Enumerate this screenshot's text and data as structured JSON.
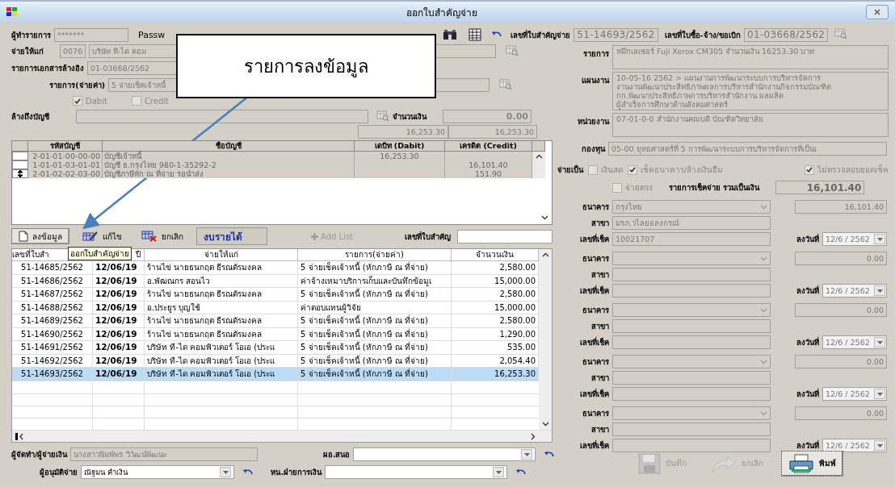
{
  "window": {
    "title": "ออกใบสำคัญจ่าย"
  },
  "top_bar": {
    "operator_label": "ผู้ทำรายการ",
    "operator_value": "*******",
    "password_label": "Passw",
    "voucher_label": "เลขที่ใบสำคัญจ่าย",
    "voucher_value": "51-14693/2562",
    "po_label": "เลขที่ใบซื้อ-จ้าง/ขอเบิก",
    "po_value": "01-03668/2562"
  },
  "callout": {
    "text": "รายการลงข้อมูล"
  },
  "entry": {
    "payee_label": "จ่ายให้แก่",
    "payee_code": "0076",
    "payee_name": "บริษัท ที-ได คอม",
    "ref_label": "รายการเอกสารล้างอิง",
    "ref_value": "01-03668/2562",
    "expense_label": "รายการ(จ่ายค่า)",
    "expense_value": "5 จ่ายเช็คเจ้าหนี้",
    "debit": {
      "label": "Dabit",
      "checked": true
    },
    "credit": {
      "label": "Credit",
      "checked": false
    },
    "account_label": "ล้างถึงบัญชี",
    "amount_label": "จำนวนเงิน",
    "amount_value": "0.00",
    "total_debit": "16,253.30",
    "total_credit": "16,253.30"
  },
  "accounts": {
    "columns": [
      "รหัสบัญชี",
      "ชื่อบัญชี",
      "เดบิท (Dabit)",
      "เครดิต (Credit)"
    ],
    "rows": [
      {
        "code": "2-01-01-00-00-00",
        "name": "บัญชีเจ้าหนี้",
        "debit": "16,253.30",
        "current": false
      },
      {
        "code": "1-01-01-03-01-01",
        "name": "บัญชี ธ.กรุงไทย 980-1-35292-2",
        "credit": "16,101.40",
        "current": false
      },
      {
        "code": "2-01-02-02-03-00",
        "name": "บัญชีภาษีหัก ณ ที่จ่าย รอนำส่ง",
        "credit": "151.90",
        "current": true
      }
    ]
  },
  "toolbar": {
    "buttons": [
      {
        "label": "ลงข้อมูล",
        "kind": "new"
      },
      {
        "label": "แก้ไข",
        "kind": "edit"
      },
      {
        "label": "ยกเลิก",
        "kind": "delete"
      }
    ],
    "budget": "งบรายได้",
    "add_list": {
      "label": "Add List",
      "disabled": true
    },
    "search_label": "เลขที่ใบสำคัญ"
  },
  "tooltip": "ออกใบสำคัญจ่าย",
  "vouchers": {
    "columns": [
      "เลขที่ใบสำ",
      "ปี",
      "จ่ายให้แก่",
      "รายการ(จ่ายค่า)",
      "จำนวนเงิน"
    ],
    "rows": [
      {
        "number": "51-14685/2562",
        "date": "12/06/19",
        "payee": "ร้านไข่ นายธนกฤต ธีรณตัรมงคล",
        "expense": "5 จ่ายเช็คเจ้าหนี้ (หักภาษี ณ ที่จ่าย)",
        "amount": "2,580.00",
        "selected": false
      },
      {
        "number": "51-14686/2562",
        "date": "12/06/19",
        "payee": "อ.พัฒณกร สอนไว",
        "expense": "ค่าจ้างเหมาบริการเก็บและบันทึกข้อมูเ",
        "amount": "15,000.00",
        "selected": false
      },
      {
        "number": "51-14687/2562",
        "date": "12/06/19",
        "payee": "ร้านไข่ นายธนกฤต ธีรณตัรมงคล",
        "expense": "5 จ่ายเช็คเจ้าหนี้ (หักภาษี ณ ที่จ่าย)",
        "amount": "2,580.00",
        "selected": false
      },
      {
        "number": "51-14688/2562",
        "date": "12/06/19",
        "payee": "อ.ประยูร บุญใช้",
        "expense": "ค่าตอบแทนผู้วิจัย",
        "amount": "15,000.00",
        "selected": false
      },
      {
        "number": "51-14689/2562",
        "date": "12/06/19",
        "payee": "ร้านไข่ นายธนกฤต ธีรณตัรมงคล",
        "expense": "5 จ่ายเช็คเจ้าหนี้ (หักภาษี ณ ที่จ่าย)",
        "amount": "2,580.00",
        "selected": false
      },
      {
        "number": "51-14690/2562",
        "date": "12/06/19",
        "payee": "ร้านไข่ นายธนกฤต ธีรณตัรมงคล",
        "expense": "5 จ่ายเช็คเจ้าหนี้ (หักภาษี ณ ที่จ่าย)",
        "amount": "1,290.00",
        "selected": false
      },
      {
        "number": "51-14691/2562",
        "date": "12/06/19",
        "payee": "บริษัท ที-ได คอมพิวเตอร์ โอเอ (ประเเ",
        "expense": "5 จ่ายเช็คเจ้าหนี้ (หักภาษี ณ ที่จ่าย)",
        "amount": "535.00",
        "selected": false
      },
      {
        "number": "51-14692/2562",
        "date": "12/06/19",
        "payee": "บริษัท ที-ได คอมพิวเตอร์ โอเอ (ประเเ",
        "expense": "5 จ่ายเช็คเจ้าหนี้ (หักภาษี ณ ที่จ่าย)",
        "amount": "2,054.40",
        "selected": false
      },
      {
        "number": "51-14693/2562",
        "date": "12/06/19",
        "payee": "บริษัท ที-ได คอมพิวเตอร์ โอเอ (ประเเ",
        "expense": "5 จ่ายเช็คเจ้าหนี้ (หักภาษี ณ ที่จ่าย)",
        "amount": "16,253.30",
        "selected": true
      }
    ]
  },
  "details": {
    "item_label": "รายการ",
    "item_value": "หมึกเลเซอร์ Fuji Xerox CM305 จำนวนเงิน 16253.30 บาท",
    "plan_label": "แผนงาน",
    "plan_lines": [
      "10-05-16 2562 > แผนงานการพัฒนาระบบการบริหารจัดการ",
      "งานงานพัฒนาประสิทธิภาพผลการบริหารสำนักงานกิจกรรมบัณฑิต",
      "กก.พัฒนาประสิทธิภาพการบริหารสำนักงาน ผลผลิต",
      "ผู้สำเร็จการศึกษาด้านสังคมศาสตร์"
    ],
    "unit_label": "หน่วยงาน",
    "unit_value": "07-01-0-0 สำนักงานคณบดี บัณฑิตวิทยาลัย",
    "fund_label": "กองทุน",
    "fund_value": "05-00 ยุทธศาสตร์ที่ 5 การพัฒนาระบบการบริหารจัดการที่เป็นเ"
  },
  "payment": {
    "label": "จ่ายเป็น",
    "options": [
      {
        "label": "เงินสด",
        "checked": false
      },
      {
        "label": "เช็คธนาคาร/ล้างเงินยืม",
        "checked": true
      },
      {
        "label": "ไม่ตรวจสอบยอดเช็ค",
        "checked": true
      },
      {
        "label": "จ่ายตรง",
        "checked": false
      }
    ],
    "total_label": "รายการเช็คจ่าย รวมเป็นเงิน",
    "total_value": "16,101.40"
  },
  "cheques": [
    {
      "bank_label": "ธนาคาร",
      "bank": "กรุงไทย",
      "amount": "16,101.40",
      "branch_label": "สาขา",
      "branch": "มรภ.วไลยอลงกรณ์",
      "no_label": "เลขที่เช็ค",
      "no": "10021707",
      "date_label": "ลงวันที่",
      "date": "12/6 / 2562"
    },
    {
      "bank_label": "ธนาคาร",
      "amount": "0.00",
      "branch_label": "สาขา",
      "no_label": "เลขที่เช็ค",
      "date_label": "ลงวันที่",
      "date": "12/6 / 2562"
    },
    {
      "bank_label": "ธนาคาร",
      "amount": "0.00",
      "branch_label": "สาขา",
      "no_label": "เลขที่เช็ค",
      "date_label": "ลงวันที่",
      "date": "12/6 / 2562"
    },
    {
      "bank_label": "ธนาคาร",
      "amount": "0.00",
      "branch_label": "สาขา",
      "no_label": "เลขที่เช็ค",
      "date_label": "ลงวันที่",
      "date": "12/6 / 2562"
    },
    {
      "bank_label": "ธนาคาร",
      "amount": "0.00",
      "branch_label": "สาขา",
      "no_label": "เลขที่เช็ค",
      "date_label": "ลงวันที่",
      "date": "12/6 / 2562"
    }
  ],
  "signers": {
    "preparer_label": "ผู้จัดทำ/ผู้จ่ายเงิน",
    "preparer": "นางสาวพิมพ์พร วิวัฒน์พัฒนะ",
    "director_label": "ผอ.สนอ",
    "approver_label": "ผู้อนุมัติจ่าย",
    "approver": "ณัฐมน คำเงิน",
    "finance_label": "หน.ฝ่ายการเงิน"
  },
  "actions": [
    {
      "label": "บันทึก",
      "kind": "save",
      "disabled": true
    },
    {
      "label": "ยกเลิก",
      "kind": "cancel",
      "disabled": true
    },
    {
      "label": "พิมพ์",
      "kind": "print",
      "disabled": false
    }
  ]
}
